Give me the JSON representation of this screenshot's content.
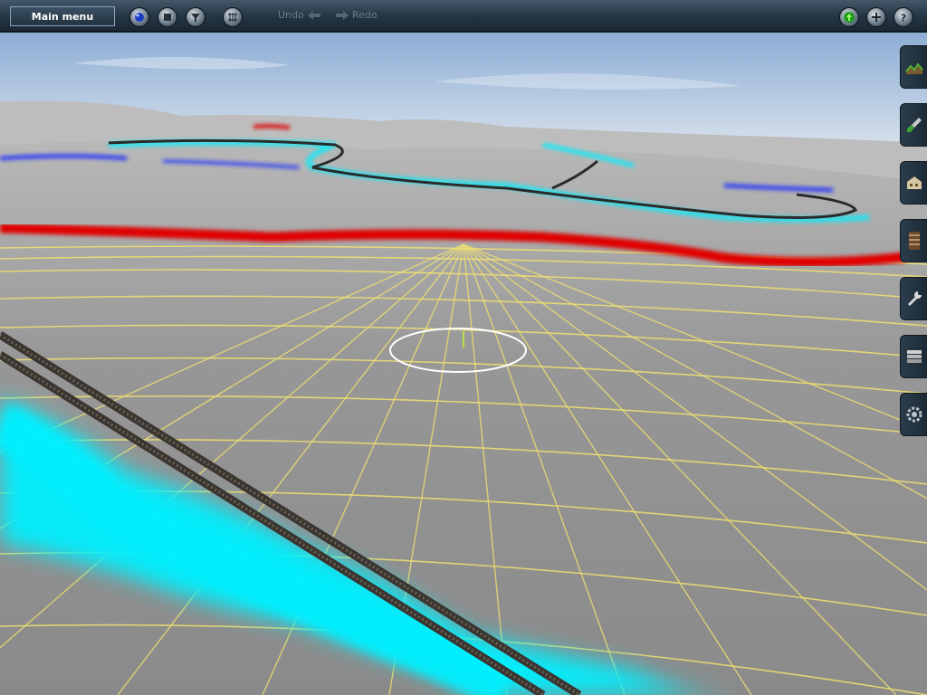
{
  "toolbar": {
    "main_menu_label": "Main menu",
    "tools": [
      {
        "name": "paint-height-tool",
        "icon": "blue-sphere-icon"
      },
      {
        "name": "stop-tool",
        "icon": "stop-square-icon"
      },
      {
        "name": "filter-tool",
        "icon": "funnel-icon"
      },
      {
        "name": "grid-tool",
        "icon": "grid-icon"
      }
    ],
    "undo_label": "Undo",
    "redo_label": "Redo",
    "right_buttons": [
      {
        "name": "status",
        "icon": "green-light-icon"
      },
      {
        "name": "add",
        "icon": "plus-icon"
      },
      {
        "name": "help",
        "icon": "question-icon"
      }
    ]
  },
  "sidebar": {
    "tabs": [
      {
        "name": "topology",
        "icon": "terrain-icon"
      },
      {
        "name": "paint",
        "icon": "paint-brush-icon"
      },
      {
        "name": "objects",
        "icon": "house-icon"
      },
      {
        "name": "track",
        "icon": "track-icon"
      },
      {
        "name": "tools",
        "icon": "wrench-icon"
      },
      {
        "name": "layers",
        "icon": "layers-icon"
      },
      {
        "name": "settings",
        "icon": "gear-icon"
      }
    ]
  },
  "colors": {
    "sky_top": "#8fb0d6",
    "terrain": "#8f8f8f",
    "grid": "#f2e46e",
    "water": "#00f0ff",
    "red_spline": "#e00000",
    "blue_spline": "#1a2cff",
    "toolbar": "#233442"
  }
}
